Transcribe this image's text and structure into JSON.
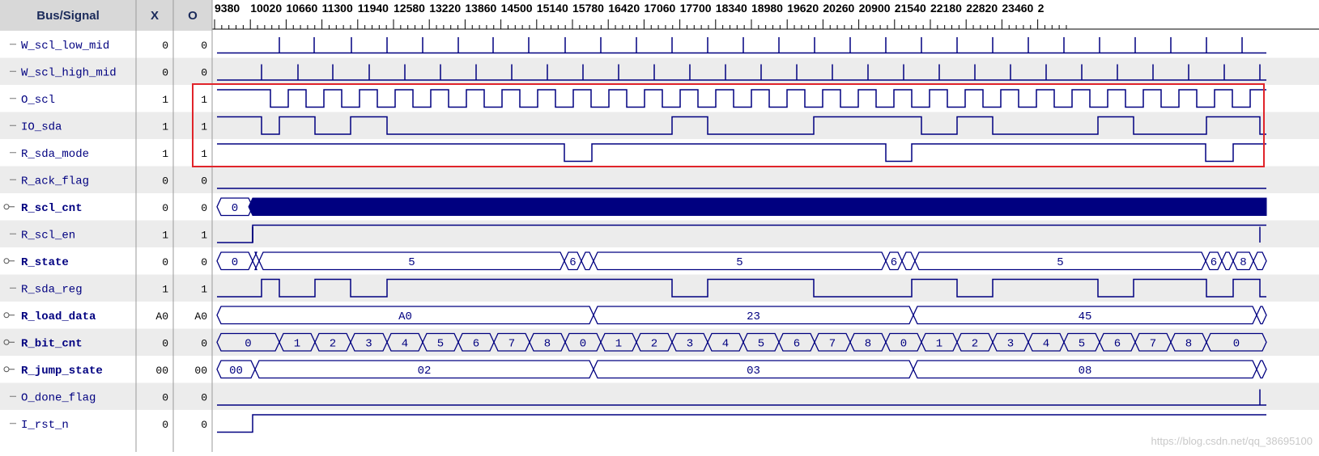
{
  "header": {
    "col_signal": "Bus/Signal",
    "col_x": "X",
    "col_o": "O",
    "time_ticks": [
      "9380",
      "10020",
      "10660",
      "11300",
      "11940",
      "12580",
      "13220",
      "13860",
      "14500",
      "15140",
      "15780",
      "16420",
      "17060",
      "17700",
      "18340",
      "18980",
      "19620",
      "20260",
      "20900",
      "21540",
      "22180",
      "22820",
      "23460",
      "2"
    ]
  },
  "signals": [
    {
      "name": "W_scl_low_mid",
      "bus": false,
      "x": "0",
      "o": "0"
    },
    {
      "name": "W_scl_high_mid",
      "bus": false,
      "x": "0",
      "o": "0"
    },
    {
      "name": "O_scl",
      "bus": false,
      "x": "1",
      "o": "1"
    },
    {
      "name": "IO_sda",
      "bus": false,
      "x": "1",
      "o": "1"
    },
    {
      "name": "R_sda_mode",
      "bus": false,
      "x": "1",
      "o": "1"
    },
    {
      "name": "R_ack_flag",
      "bus": false,
      "x": "0",
      "o": "0"
    },
    {
      "name": "R_scl_cnt",
      "bus": true,
      "x": "0",
      "o": "0"
    },
    {
      "name": "R_scl_en",
      "bus": false,
      "x": "1",
      "o": "1"
    },
    {
      "name": "R_state",
      "bus": true,
      "x": "0",
      "o": "0"
    },
    {
      "name": "R_sda_reg",
      "bus": false,
      "x": "1",
      "o": "1"
    },
    {
      "name": "R_load_data",
      "bus": true,
      "x": "A0",
      "o": "A0"
    },
    {
      "name": "R_bit_cnt",
      "bus": true,
      "x": "0",
      "o": "0"
    },
    {
      "name": "R_jump_state",
      "bus": true,
      "x": "00",
      "o": "00"
    },
    {
      "name": "O_done_flag",
      "bus": false,
      "x": "0",
      "o": "0"
    },
    {
      "name": "I_rst_n",
      "bus": false,
      "x": "0",
      "o": "0"
    }
  ],
  "bus_values": {
    "R_scl_cnt": [
      "0"
    ],
    "R_state": [
      "0",
      "5",
      "6",
      "5",
      "6",
      "5",
      "6",
      "8"
    ],
    "R_load_data": [
      "A0",
      "23",
      "45"
    ],
    "R_bit_cnt": [
      "0",
      "1",
      "2",
      "3",
      "4",
      "5",
      "6",
      "7",
      "8",
      "0",
      "1",
      "2",
      "3",
      "4",
      "5",
      "6",
      "7",
      "8",
      "0",
      "1",
      "2",
      "3",
      "4",
      "5",
      "6",
      "7",
      "8",
      "0"
    ],
    "R_jump_state": [
      "00",
      "02",
      "03",
      "08"
    ]
  },
  "watermark": "https://blog.csdn.net/qq_38695100",
  "colors": {
    "wave": "#000080",
    "grid_bg": "#ececec",
    "header_bg": "#d8d8d8",
    "highlight": "#e0242a",
    "label": "#000080"
  }
}
